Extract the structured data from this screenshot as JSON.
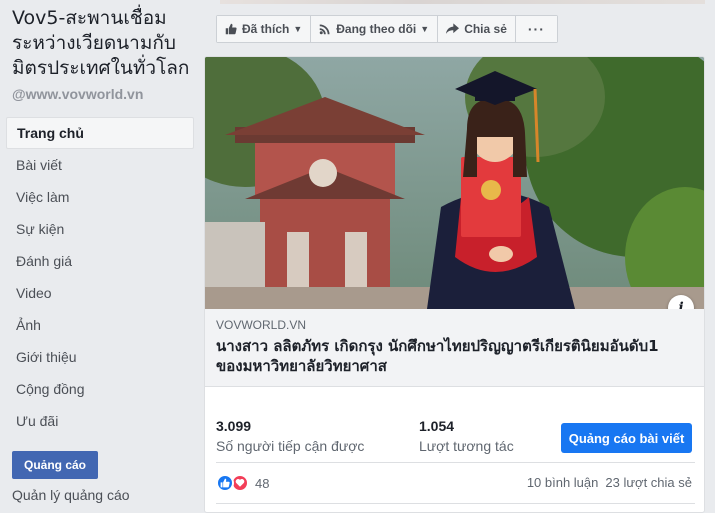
{
  "sidebar": {
    "page_name": "Vov5-สะพานเชื่อมระหว่างเวียดนามกับมิตรประเทศในทั่วโลก",
    "handle": "@www.vovworld.vn",
    "nav": [
      {
        "label": "Trang chủ",
        "active": true
      },
      {
        "label": "Bài viết"
      },
      {
        "label": "Việc làm"
      },
      {
        "label": "Sự kiện"
      },
      {
        "label": "Đánh giá"
      },
      {
        "label": "Video"
      },
      {
        "label": "Ảnh"
      },
      {
        "label": "Giới thiệu"
      },
      {
        "label": "Cộng đồng"
      },
      {
        "label": "Ưu đãi"
      }
    ],
    "ad_button": "Quảng cáo",
    "ad_manage": "Quản lý quảng cáo"
  },
  "actions": {
    "liked": "Đã thích",
    "following": "Đang theo dõi",
    "share": "Chia sẻ",
    "more": "···"
  },
  "post": {
    "image_icon": "info-icon",
    "image_icon_glyph": "i",
    "link": {
      "domain": "VOVWORLD.VN",
      "title": "นางสาว ลลิตภัทร เกิดกรุง นักศึกษาไทยปริญญาตรีเกียรตินิยมอันดับ1 ของมหาวิทยาลัยวิทยาศาส"
    },
    "stats": {
      "reach_value": "3.099",
      "reach_label": "Số người tiếp cận được",
      "engagement_value": "1.054",
      "engagement_label": "Lượt tương tác",
      "boost_button": "Quảng cáo bài viết"
    },
    "reactions": {
      "icons": [
        "like-icon",
        "love-icon"
      ],
      "count": "48",
      "comments": "10 bình luận",
      "shares": "23 lượt chia sẻ"
    }
  },
  "colors": {
    "brand": "#4267b2",
    "boost": "#1877f2",
    "like": "#1877f2",
    "love": "#f33e58",
    "page_bg": "#e9ebee"
  }
}
